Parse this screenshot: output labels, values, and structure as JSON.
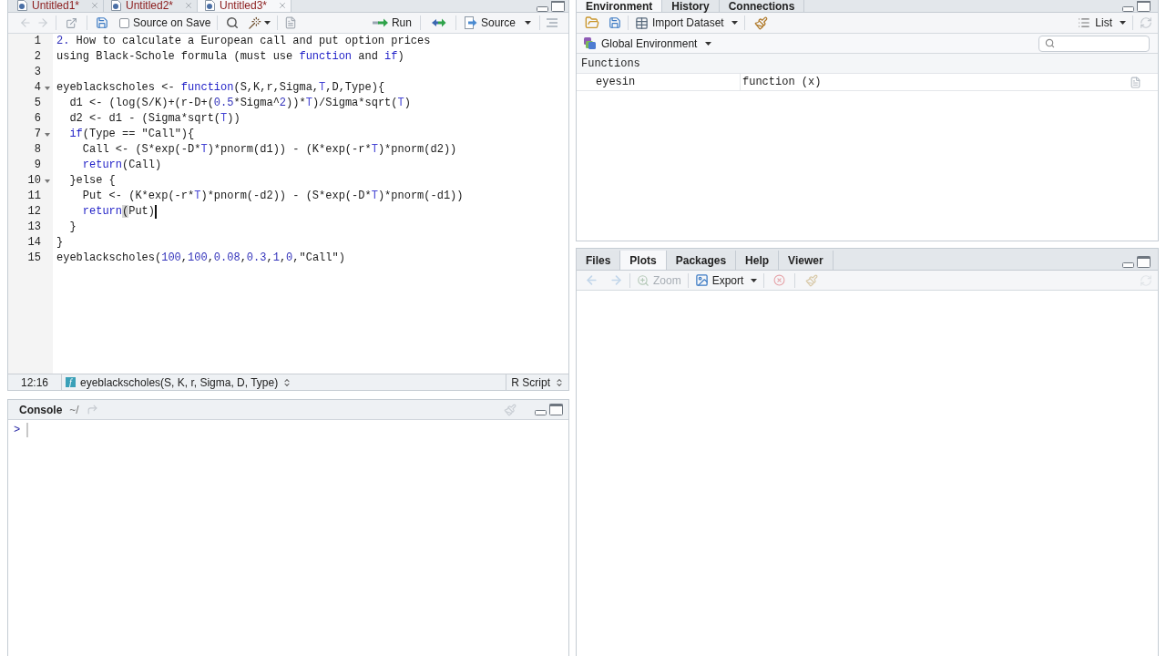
{
  "source_pane": {
    "tabs": [
      {
        "label": "Untitled1*",
        "selected": false
      },
      {
        "label": "Untitled2*",
        "selected": false
      },
      {
        "label": "Untitled3*",
        "selected": true
      }
    ],
    "toolbar": {
      "nav": {
        "disabled": true
      },
      "source_on_save": {
        "label": "Source on Save",
        "checked": false
      },
      "run": {
        "label": "Run"
      },
      "source": {
        "label": "Source"
      }
    },
    "lines": [
      {
        "number": "1",
        "fold": false,
        "cursor": false,
        "tokens": [
          {
            "kind": "number",
            "text": "2."
          },
          {
            "kind": "plain",
            "text": " How to calculate a European call and put option prices"
          }
        ]
      },
      {
        "number": "2",
        "fold": false,
        "cursor": false,
        "tokens": [
          {
            "kind": "plain",
            "text": "using Black-Schole formula (must use "
          },
          {
            "kind": "keyword",
            "text": "function"
          },
          {
            "kind": "plain",
            "text": " and "
          },
          {
            "kind": "keyword",
            "text": "if"
          },
          {
            "kind": "plain",
            "text": ")"
          }
        ]
      },
      {
        "number": "3",
        "fold": false,
        "cursor": false
      },
      {
        "number": "4",
        "fold": true,
        "cursor": false,
        "tokens": [
          {
            "kind": "plain",
            "text": "eyeblackscholes <- "
          },
          {
            "kind": "keyword",
            "text": "function"
          },
          {
            "kind": "plain",
            "text": "(S,K,r,Sigma,"
          },
          {
            "kind": "constant",
            "text": "T"
          },
          {
            "kind": "plain",
            "text": ",D,Type){"
          }
        ]
      },
      {
        "number": "5",
        "fold": false,
        "cursor": false,
        "tokens": [
          {
            "kind": "plain",
            "text": "  d1 <- (log(S/K)+(r-D+("
          },
          {
            "kind": "number",
            "text": "0.5"
          },
          {
            "kind": "plain",
            "text": "*Sigma^"
          },
          {
            "kind": "number",
            "text": "2"
          },
          {
            "kind": "plain",
            "text": "))*"
          },
          {
            "kind": "constant",
            "text": "T"
          },
          {
            "kind": "plain",
            "text": ")/Sigma*sqrt("
          },
          {
            "kind": "constant",
            "text": "T"
          },
          {
            "kind": "plain",
            "text": ")"
          }
        ]
      },
      {
        "number": "6",
        "fold": false,
        "cursor": false,
        "tokens": [
          {
            "kind": "plain",
            "text": "  d2 <- d1 - (Sigma*sqrt("
          },
          {
            "kind": "constant",
            "text": "T"
          },
          {
            "kind": "plain",
            "text": "))"
          }
        ]
      },
      {
        "number": "7",
        "fold": true,
        "cursor": false,
        "tokens": [
          {
            "kind": "keyword",
            "text": "  if"
          },
          {
            "kind": "plain",
            "text": "(Type == \"Call\"){"
          }
        ]
      },
      {
        "number": "8",
        "fold": false,
        "cursor": false,
        "tokens": [
          {
            "kind": "plain",
            "text": "    Call <- (S*exp(-D*"
          },
          {
            "kind": "constant",
            "text": "T"
          },
          {
            "kind": "plain",
            "text": ")*pnorm(d1)) - (K*exp(-r*"
          },
          {
            "kind": "constant",
            "text": "T"
          },
          {
            "kind": "plain",
            "text": ")*pnorm(d2))"
          }
        ]
      },
      {
        "number": "9",
        "fold": false,
        "cursor": false,
        "tokens": [
          {
            "kind": "keyword",
            "text": "    return"
          },
          {
            "kind": "plain",
            "text": "(Call)"
          }
        ]
      },
      {
        "number": "10",
        "fold": true,
        "cursor": false,
        "tokens": [
          {
            "kind": "plain",
            "text": "  }else {"
          }
        ]
      },
      {
        "number": "11",
        "fold": false,
        "cursor": false,
        "tokens": [
          {
            "kind": "plain",
            "text": "    Put <- (K*exp(-r*"
          },
          {
            "kind": "constant",
            "text": "T"
          },
          {
            "kind": "plain",
            "text": ")*pnorm(-d2)) - (S*exp(-D*"
          },
          {
            "kind": "constant",
            "text": "T"
          },
          {
            "kind": "plain",
            "text": ")*pnorm(-d1))"
          }
        ]
      },
      {
        "number": "12",
        "fold": false,
        "cursor": true,
        "tokens": [
          {
            "kind": "keyword",
            "text": "    return"
          },
          {
            "kind": "match",
            "text": "("
          },
          {
            "kind": "plain",
            "text": "Put)"
          }
        ]
      },
      {
        "number": "13",
        "fold": false,
        "cursor": false,
        "tokens": [
          {
            "kind": "plain",
            "text": "  }"
          }
        ]
      },
      {
        "number": "14",
        "fold": false,
        "cursor": false,
        "tokens": [
          {
            "kind": "plain",
            "text": "}"
          }
        ]
      },
      {
        "number": "15",
        "fold": false,
        "cursor": false,
        "tokens": [
          {
            "kind": "plain",
            "text": "eyeblackscholes("
          },
          {
            "kind": "number",
            "text": "100"
          },
          {
            "kind": "plain",
            "text": ","
          },
          {
            "kind": "number",
            "text": "100"
          },
          {
            "kind": "plain",
            "text": ","
          },
          {
            "kind": "number",
            "text": "0.08"
          },
          {
            "kind": "plain",
            "text": ","
          },
          {
            "kind": "number",
            "text": "0.3"
          },
          {
            "kind": "plain",
            "text": ","
          },
          {
            "kind": "number",
            "text": "1"
          },
          {
            "kind": "plain",
            "text": ","
          },
          {
            "kind": "number",
            "text": "0"
          },
          {
            "kind": "plain",
            "text": ",\"Call\")"
          }
        ]
      }
    ],
    "status_bar": {
      "position": "12:16",
      "scope_badge": "f",
      "scope": "eyeblackscholes(S, K, r, Sigma, D, Type)",
      "file_type": "R Script"
    }
  },
  "console": {
    "title": "Console",
    "path": "~/",
    "prompt": ">"
  },
  "environment_pane": {
    "tabs": [
      {
        "label": "Environment",
        "selected": true
      },
      {
        "label": "History",
        "selected": false
      },
      {
        "label": "Connections",
        "selected": false
      }
    ],
    "toolbar": {
      "import": {
        "label": "Import Dataset"
      },
      "view": {
        "label": "List"
      }
    },
    "scope": {
      "label": "Global Environment"
    },
    "sections": [
      {
        "title": "Functions",
        "rows": [
          {
            "name": "eyesin",
            "value": "function (x)"
          }
        ]
      }
    ]
  },
  "plots_pane": {
    "tabs": [
      {
        "label": "Files",
        "selected": false
      },
      {
        "label": "Plots",
        "selected": true
      },
      {
        "label": "Packages",
        "selected": false
      },
      {
        "label": "Help",
        "selected": false
      },
      {
        "label": "Viewer",
        "selected": false
      }
    ],
    "toolbar": {
      "nav": {
        "disabled": true
      },
      "zoom": {
        "label": "Zoom",
        "disabled": true
      },
      "export": {
        "label": "Export",
        "disabled": false
      }
    }
  }
}
